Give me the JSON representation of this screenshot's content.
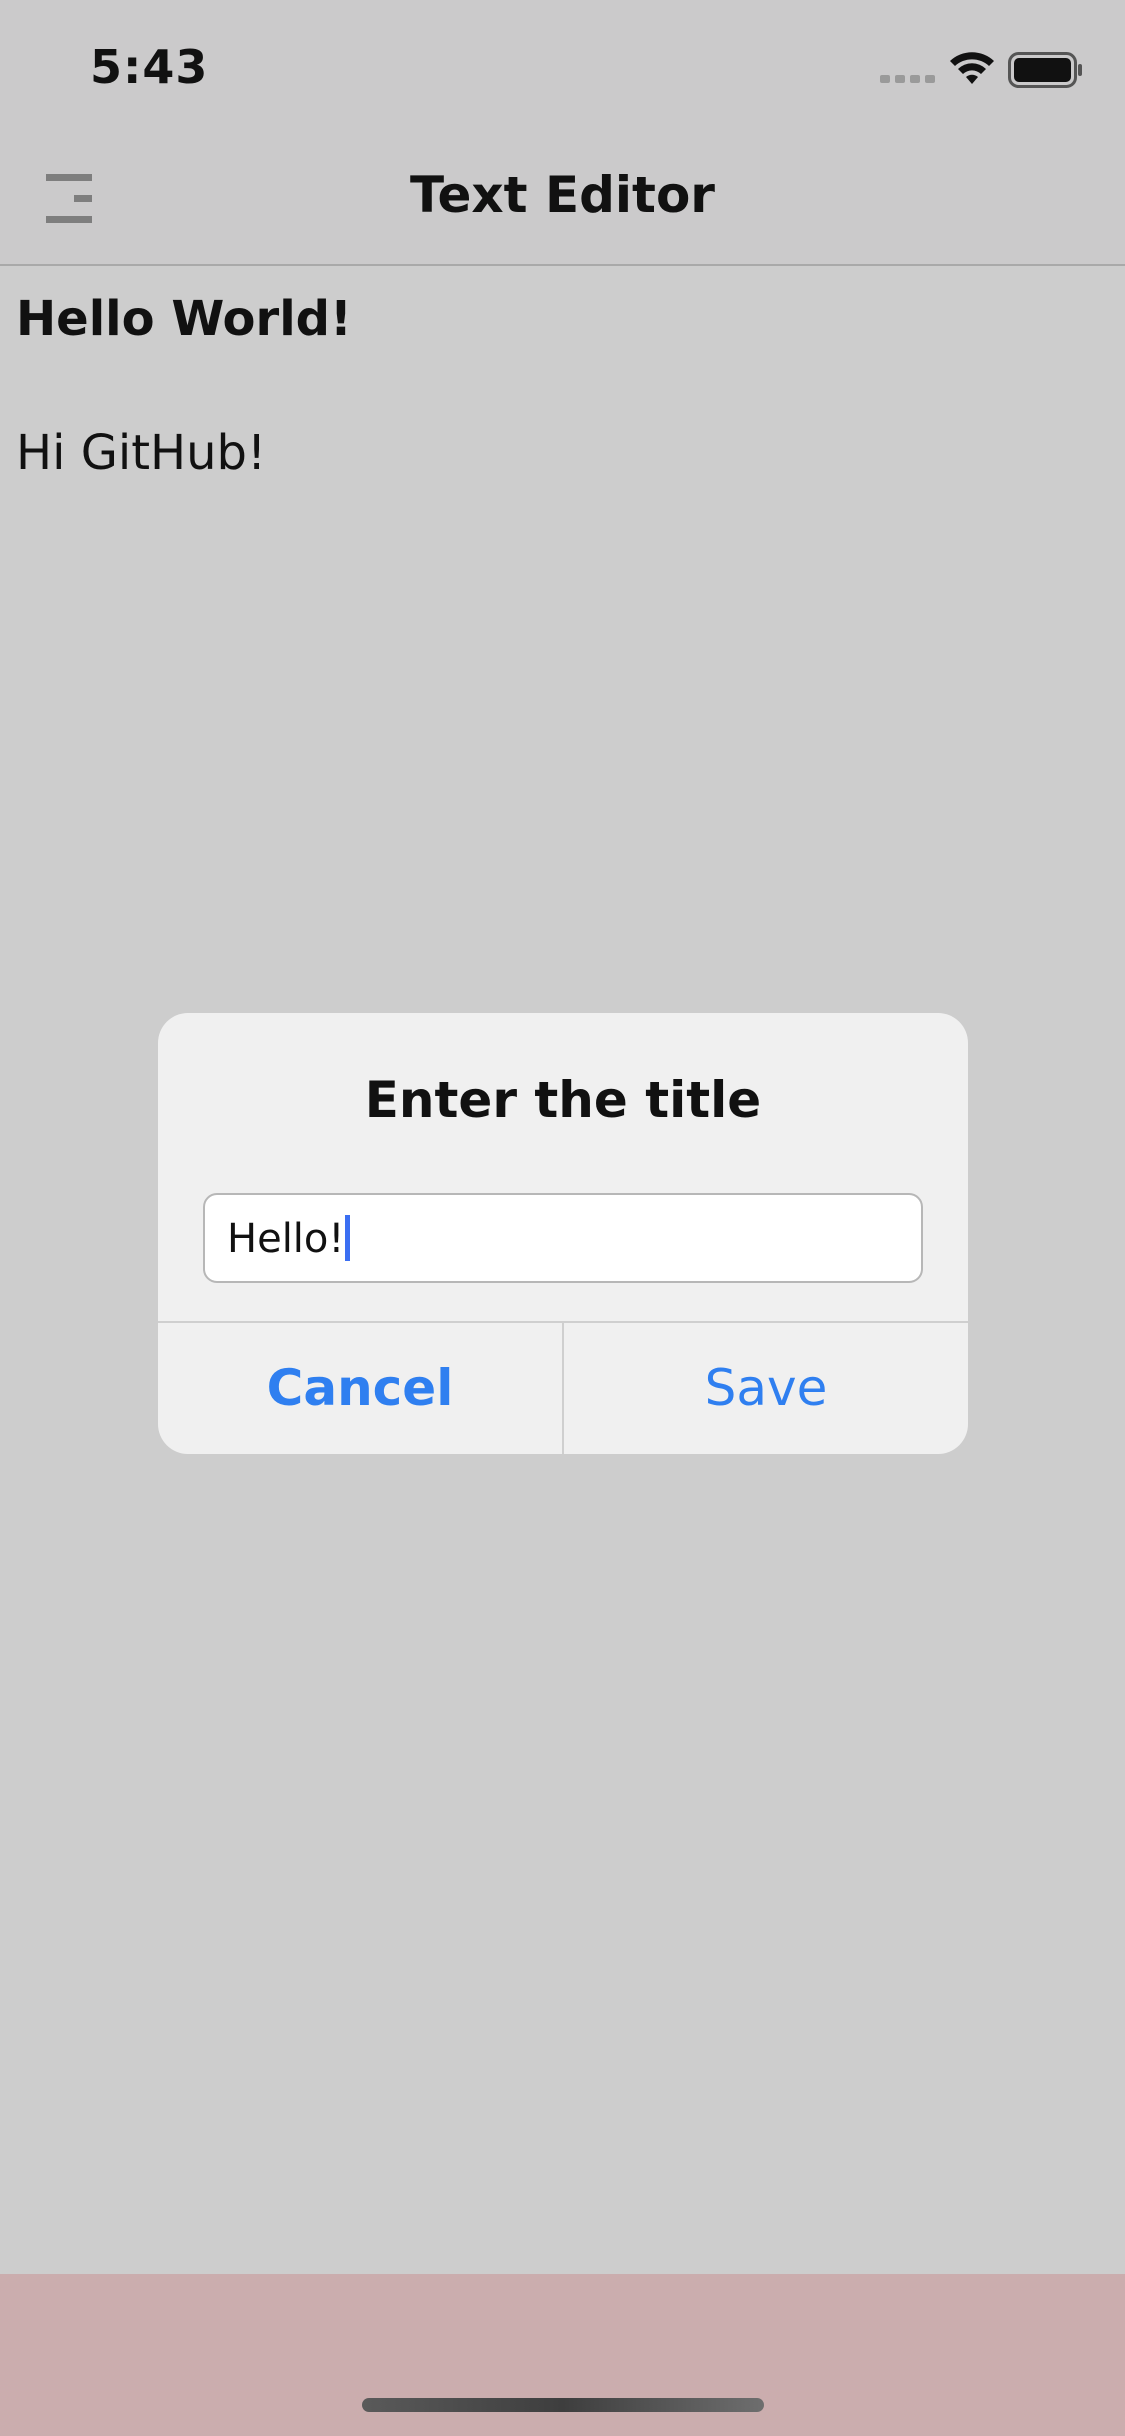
{
  "status_bar": {
    "time": "5:43",
    "icons": [
      "cellular-signal-icon",
      "wifi-icon",
      "battery-icon"
    ]
  },
  "nav": {
    "title": "Text Editor",
    "left_icon": "hamburger-menu-icon"
  },
  "document": {
    "heading": "Hello World!",
    "body": "Hi GitHub!"
  },
  "alert": {
    "title": "Enter the title",
    "field_value": "Hello!",
    "cancel_label": "Cancel",
    "save_label": "Save"
  },
  "colors": {
    "accent": "#2f7ff0",
    "background": "#cdcdcd",
    "bottom_area": "#cbadae",
    "caret": "#3b6ff2"
  }
}
